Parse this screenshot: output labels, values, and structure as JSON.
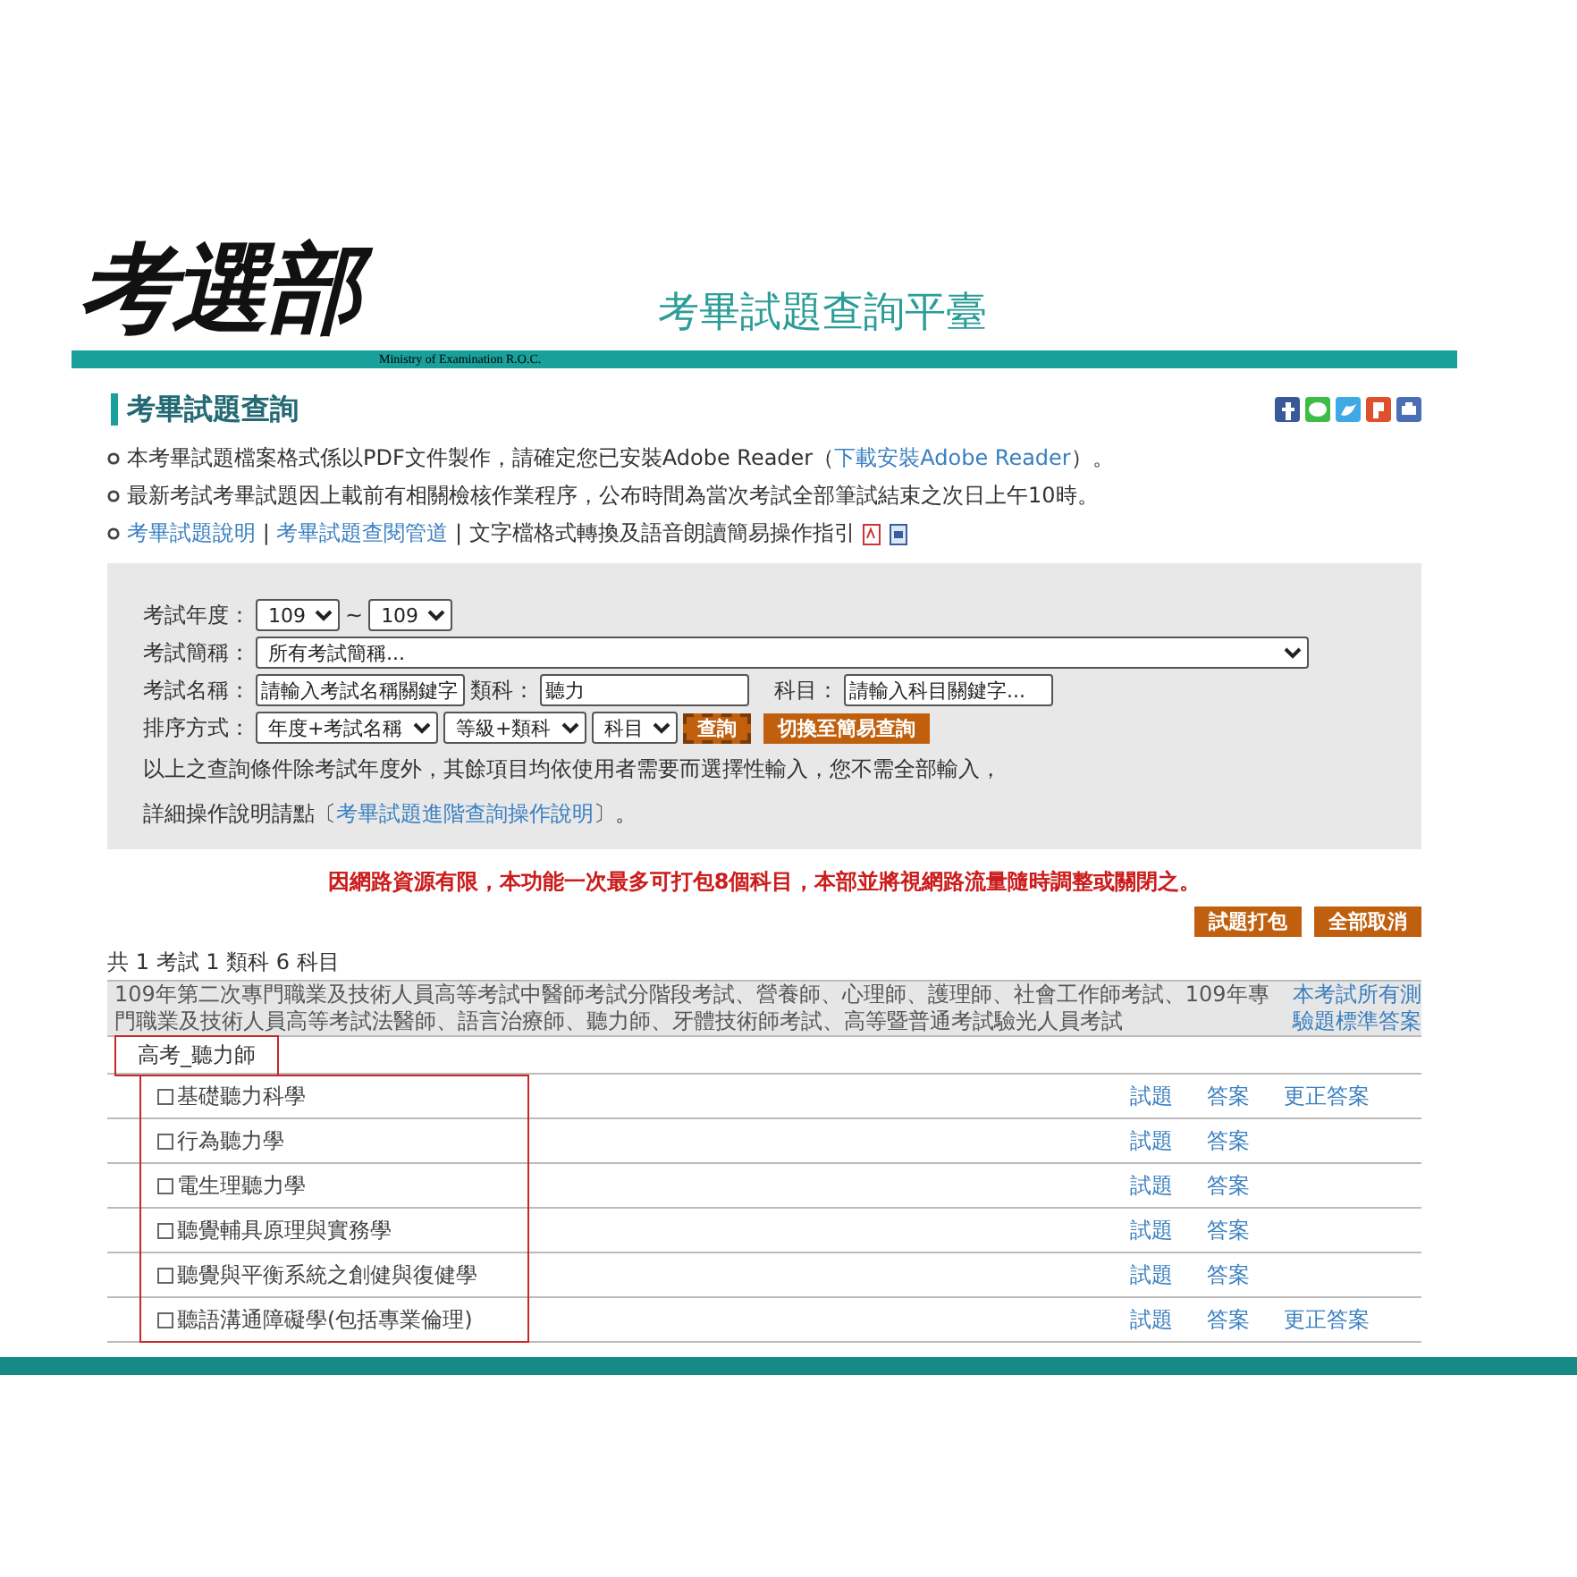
{
  "header": {
    "logo": "考選部",
    "logo_subtitle": "Ministry of Examination R.O.C.",
    "title": "考畢試題查詢平臺"
  },
  "page_title": "考畢試題查詢",
  "notices": [
    {
      "segments": [
        {
          "text": "本考畢試題檔案格式係以PDF文件製作，請確定您已安裝Adobe Reader（"
        },
        {
          "text": "下載安裝Adobe Reader",
          "link": true
        },
        {
          "text": "）。"
        }
      ]
    },
    {
      "segments": [
        {
          "text": "最新考試考畢試題因上載前有相關檢核作業程序，公布時間為當次考試全部筆試結束之次日上午10時。"
        }
      ]
    },
    {
      "segments": [
        {
          "text": "考畢試題說明",
          "link": true
        },
        {
          "text": " | "
        },
        {
          "text": "考畢試題查閱管道",
          "link": true
        },
        {
          "text": " | 文字檔格式轉換及語音朗讀簡易操作指引"
        }
      ],
      "file_icons": true
    }
  ],
  "search": {
    "year_label": "考試年度：",
    "year_from": "109",
    "year_sep": "~",
    "year_to": "109",
    "abbrev_label": "考試簡稱：",
    "abbrev_value": "所有考試簡稱...",
    "name_label": "考試名稱：",
    "name_placeholder": "請輸入考試名稱關鍵字",
    "category_label": "類科：",
    "category_value": "聽力",
    "subject_label": "科目：",
    "subject_placeholder": "請輸入科目關鍵字...",
    "sort_label": "排序方式：",
    "sort_values": [
      "年度+考試名稱",
      "等級+類科",
      "科目"
    ],
    "buttons": [
      {
        "label": "查詢",
        "focused": true
      },
      {
        "label": "切換至簡易查詢",
        "focused": false
      }
    ],
    "hint": "以上之查詢條件除考試年度外，其餘項目均依使用者需要而選擇性輸入，您不需全部輸入，",
    "help": [
      {
        "text": "詳細操作說明請點〔"
      },
      {
        "text": "考畢試題進階查詢操作說明",
        "link": true
      },
      {
        "text": "〕。"
      }
    ]
  },
  "warning": "因網路資源有限，本功能一次最多可打包8個科目，本部並將視網路流量隨時調整或關閉之。",
  "actions": [
    "試題打包",
    "全部取消"
  ],
  "summary": "共 1 考試 1 類科 6 科目",
  "exam": {
    "name": "109年第二次專門職業及技術人員高等考試中醫師考試分階段考試、營養師、心理師、護理師、社會工作師考試、109年專門職業及技術人員高等考試法醫師、語言治療師、聽力師、牙體技術師考試、高等暨普通考試驗光人員考試",
    "link": "本考試所有測驗題標準答案"
  },
  "category": {
    "name": "高考_聽力師",
    "highlighted": true
  },
  "subjects_highlighted": true,
  "subjects": [
    {
      "name": "基礎聽力科學",
      "checked": false,
      "links": [
        "試題",
        "答案",
        "更正答案"
      ]
    },
    {
      "name": "行為聽力學",
      "checked": false,
      "links": [
        "試題",
        "答案"
      ]
    },
    {
      "name": "電生理聽力學",
      "checked": false,
      "links": [
        "試題",
        "答案"
      ]
    },
    {
      "name": "聽覺輔具原理與實務學",
      "checked": false,
      "links": [
        "試題",
        "答案"
      ]
    },
    {
      "name": "聽覺與平衡系統之創健與復健學",
      "checked": false,
      "links": [
        "試題",
        "答案"
      ]
    },
    {
      "name": "聽語溝通障礙學(包括專業倫理)",
      "checked": false,
      "links": [
        "試題",
        "答案",
        "更正答案"
      ]
    }
  ]
}
